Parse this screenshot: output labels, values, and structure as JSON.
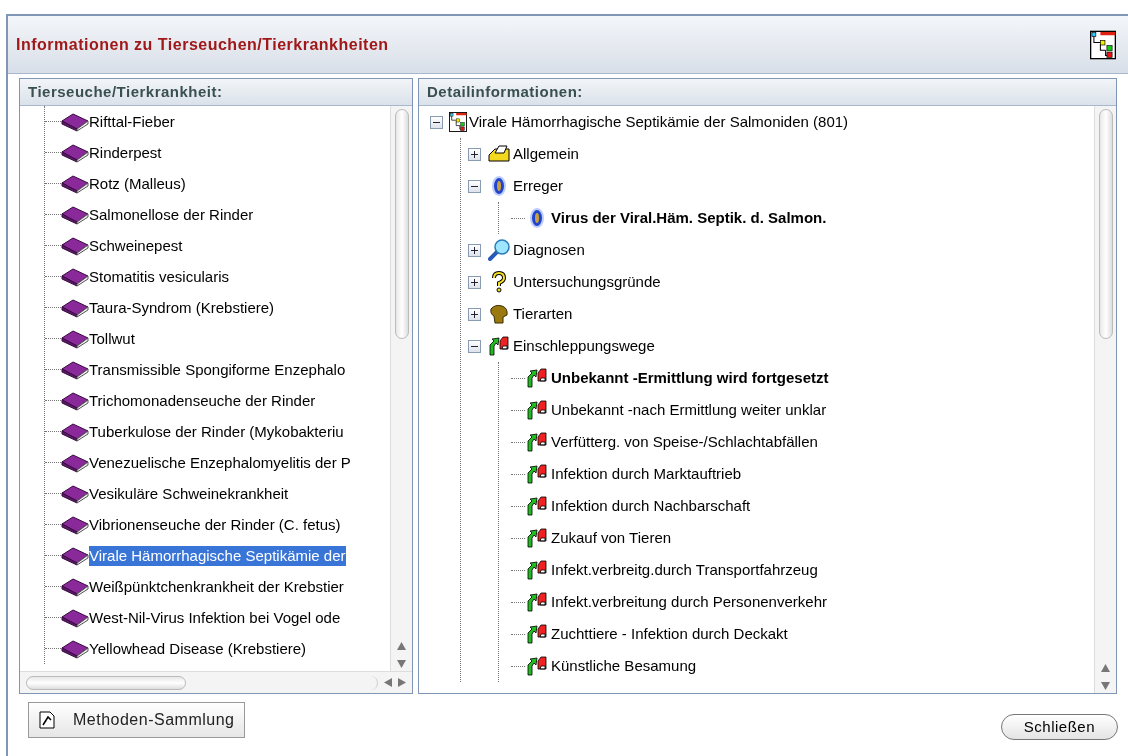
{
  "window": {
    "title": "Informationen zu Tierseuchen/Tierkrankheiten"
  },
  "left_panel": {
    "heading": "Tierseuche/Tierkrankheit:",
    "items": [
      {
        "label": "Rifttal-Fieber",
        "selected": false
      },
      {
        "label": "Rinderpest",
        "selected": false
      },
      {
        "label": "Rotz (Malleus)",
        "selected": false
      },
      {
        "label": "Salmonellose der Rinder",
        "selected": false
      },
      {
        "label": "Schweinepest",
        "selected": false
      },
      {
        "label": "Stomatitis vesicularis",
        "selected": false
      },
      {
        "label": "Taura-Syndrom (Krebstiere)",
        "selected": false
      },
      {
        "label": "Tollwut",
        "selected": false
      },
      {
        "label": "Transmissible Spongiforme Enzephalo",
        "selected": false
      },
      {
        "label": "Trichomonadenseuche der Rinder",
        "selected": false
      },
      {
        "label": "Tuberkulose der Rinder (Mykobakteriu",
        "selected": false
      },
      {
        "label": "Venezuelische Enzephalomyelitis der P",
        "selected": false
      },
      {
        "label": "Vesikuläre Schweinekrankheit",
        "selected": false
      },
      {
        "label": "Vibrionenseuche der Rinder (C. fetus)",
        "selected": false
      },
      {
        "label": "Virale Hämorrhagische Septikämie der",
        "selected": true
      },
      {
        "label": "Weißpünktchenkrankheit der Krebstier",
        "selected": false
      },
      {
        "label": "West-Nil-Virus Infektion bei Vogel ode",
        "selected": false
      },
      {
        "label": "Yellowhead Disease (Krebstiere)",
        "selected": false
      }
    ]
  },
  "right_panel": {
    "heading": "Detailinformationen:",
    "tree": {
      "label": "Virale Hämorrhagische Septikämie der Salmoniden (801)",
      "kind": "root",
      "expanded": true,
      "bold": false,
      "children": [
        {
          "label": "Allgemein",
          "kind": "general",
          "expanded": false,
          "bold": false
        },
        {
          "label": "Erreger",
          "kind": "pathogen",
          "expanded": true,
          "bold": false,
          "children": [
            {
              "label": "Virus der Viral.Häm. Septik. d. Salmon.",
              "kind": "pathogen",
              "bold": true
            }
          ]
        },
        {
          "label": "Diagnosen",
          "kind": "diagnosis",
          "expanded": false,
          "bold": false
        },
        {
          "label": "Untersuchungsgründe",
          "kind": "question",
          "expanded": false,
          "bold": false
        },
        {
          "label": "Tierarten",
          "kind": "animal",
          "expanded": false,
          "bold": false
        },
        {
          "label": "Einschleppungswege",
          "kind": "route",
          "expanded": true,
          "bold": false,
          "children": [
            {
              "label": "Unbekannt -Ermittlung wird fortgesetzt",
              "kind": "route",
              "bold": true
            },
            {
              "label": "Unbekannt -nach Ermittlung weiter unklar",
              "kind": "route",
              "bold": false
            },
            {
              "label": "Verfütterg. von Speise-/Schlachtabfällen",
              "kind": "route",
              "bold": false
            },
            {
              "label": "Infektion durch Marktauftrieb",
              "kind": "route",
              "bold": false
            },
            {
              "label": "Infektion durch Nachbarschaft",
              "kind": "route",
              "bold": false
            },
            {
              "label": "Zukauf von Tieren",
              "kind": "route",
              "bold": false
            },
            {
              "label": "Infekt.verbreitg.durch Transportfahrzeug",
              "kind": "route",
              "bold": false
            },
            {
              "label": "Infekt.verbreitung durch Personenverkehr",
              "kind": "route",
              "bold": false
            },
            {
              "label": "Zuchttiere - Infektion durch Deckakt",
              "kind": "route",
              "bold": false
            },
            {
              "label": "Künstliche Besamung",
              "kind": "route",
              "bold": false
            }
          ]
        }
      ]
    }
  },
  "buttons": [
    {
      "label": "Methoden-Sammlung",
      "kind": "methods"
    },
    {
      "label": "Schließen",
      "kind": "close"
    }
  ]
}
